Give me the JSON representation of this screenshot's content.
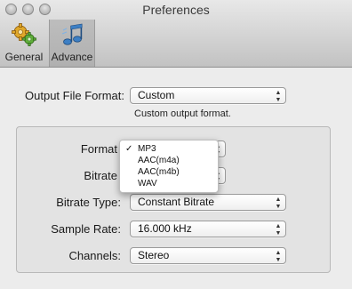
{
  "window": {
    "title": "Preferences"
  },
  "toolbar": {
    "items": [
      {
        "label": "General",
        "icon": "gears-icon",
        "selected": false
      },
      {
        "label": "Advance",
        "icon": "music-note-icon",
        "selected": true
      }
    ]
  },
  "output_format": {
    "label": "Output File Format:",
    "value": "Custom",
    "hint": "Custom output format."
  },
  "settings": {
    "format": {
      "label": "Format",
      "value": "MP3"
    },
    "bitrate": {
      "label": "Bitrate"
    },
    "bitrate_type": {
      "label": "Bitrate Type:",
      "value": "Constant Bitrate"
    },
    "sample_rate": {
      "label": "Sample Rate:",
      "value": "16.000 kHz"
    },
    "channels": {
      "label": "Channels:",
      "value": "Stereo"
    }
  },
  "format_menu": {
    "items": [
      {
        "label": "MP3",
        "checked": true,
        "check": "✓"
      },
      {
        "label": "AAC(m4a)",
        "checked": false
      },
      {
        "label": "AAC(m4b)",
        "checked": false
      },
      {
        "label": "WAV",
        "checked": false
      }
    ]
  },
  "colors": {
    "toolbar_selected": "#b4b4b4",
    "group_box": "#e3e3e3"
  }
}
